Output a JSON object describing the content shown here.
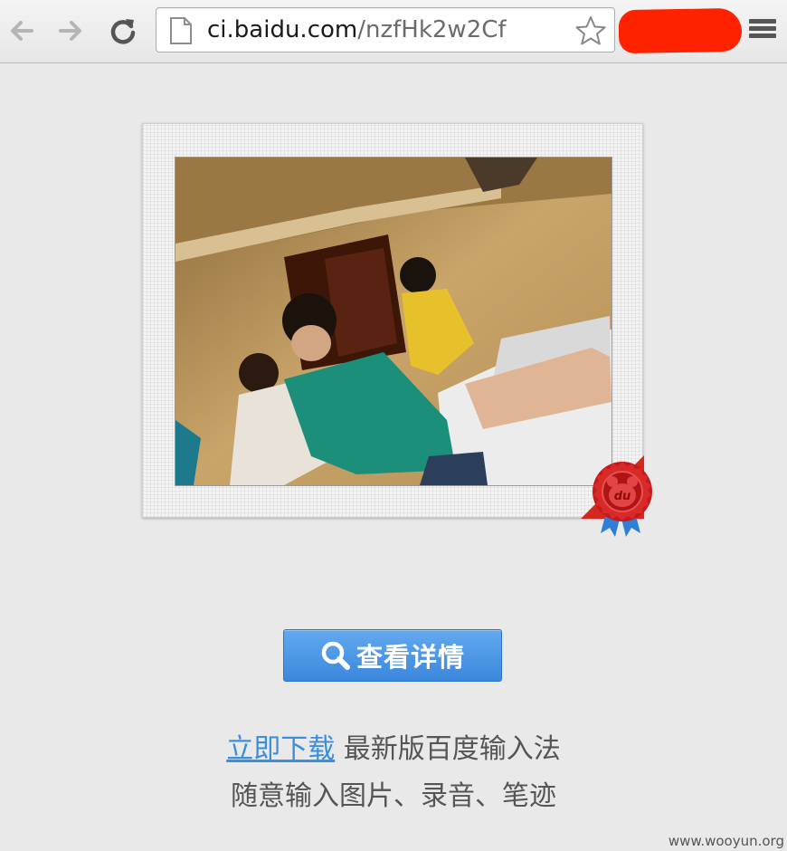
{
  "browser": {
    "url_host": "ci.baidu.com",
    "url_path": "/nzfHk2w2Cf"
  },
  "main": {
    "view_details_label": "查看详情",
    "download_link": "立即下载",
    "download_desc": "最新版百度输入法",
    "tagline": "随意输入图片、录音、笔迹",
    "seal_text": "du"
  },
  "watermark": "www.wooyun.org",
  "colors": {
    "accent": "#3b87dc",
    "link": "#3a8ee0",
    "seal_red": "#d11f1f",
    "ribbon_blue": "#2f7fd6"
  },
  "icons": [
    "back-icon",
    "forward-icon",
    "reload-icon",
    "page-icon",
    "star-icon",
    "menu-icon",
    "search-icon",
    "award-seal-icon"
  ]
}
